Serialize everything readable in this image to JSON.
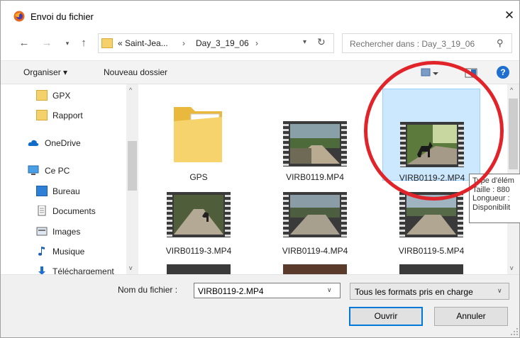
{
  "window": {
    "title": "Envoi du fichier"
  },
  "address": {
    "crumbs": [
      "« Saint-Jea...",
      "Day_3_19_06"
    ],
    "separator": "›"
  },
  "search": {
    "placeholder": "Rechercher dans : Day_3_19_06"
  },
  "toolbar": {
    "organize": "Organiser ▾",
    "new_folder": "Nouveau dossier"
  },
  "nav": {
    "items": [
      {
        "label": "GPX",
        "icon": "folder-icon"
      },
      {
        "label": "Rapport",
        "icon": "folder-icon"
      },
      {
        "label": "OneDrive",
        "icon": "cloud-icon"
      },
      {
        "label": "Ce PC",
        "icon": "computer-icon"
      },
      {
        "label": "Bureau",
        "icon": "desktop-icon"
      },
      {
        "label": "Documents",
        "icon": "documents-icon"
      },
      {
        "label": "Images",
        "icon": "images-icon"
      },
      {
        "label": "Musique",
        "icon": "music-icon"
      },
      {
        "label": "Téléchargement",
        "icon": "download-icon"
      }
    ]
  },
  "files": [
    {
      "name": "GPS",
      "kind": "folder"
    },
    {
      "name": "VIRB0119.MP4",
      "kind": "video"
    },
    {
      "name": "VIRB0119-2.MP4",
      "kind": "video",
      "selected": true
    },
    {
      "name": "VIRB0119-3.MP4",
      "kind": "video"
    },
    {
      "name": "VIRB0119-4.MP4",
      "kind": "video"
    },
    {
      "name": "VIRB0119-5.MP4",
      "kind": "video"
    }
  ],
  "tooltip": {
    "lines": [
      "Type d'élém",
      "Taille : 880",
      "Longueur :",
      "Disponibilit"
    ]
  },
  "footer": {
    "filename_label": "Nom du fichier :",
    "filename_value": "VIRB0119-2.MP4",
    "filetype_value": "Tous les formats pris en charge",
    "open_label": "Ouvrir",
    "cancel_label": "Annuler"
  },
  "colors": {
    "accent": "#0078d7",
    "selection": "#cce8ff",
    "annotation": "#e0242a"
  }
}
